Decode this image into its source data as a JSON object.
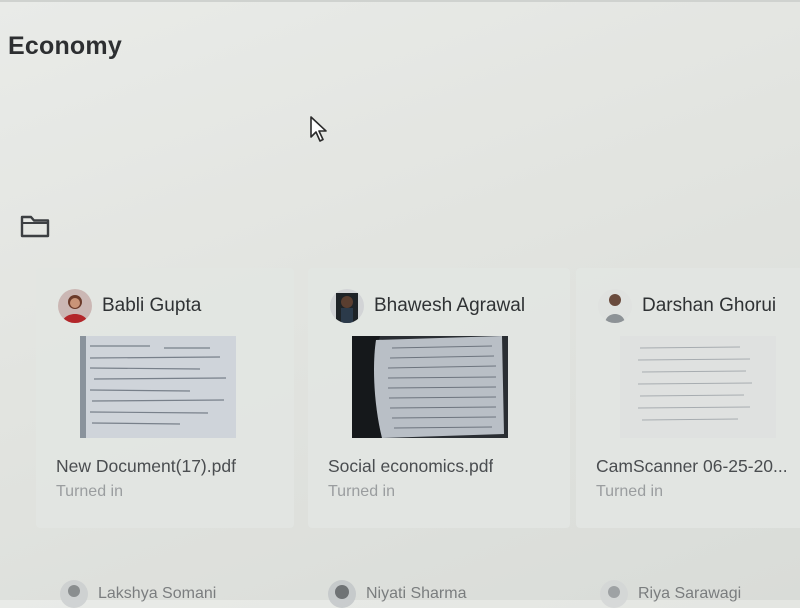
{
  "page": {
    "title": "Economy"
  },
  "icons": {
    "folder": "folder-icon",
    "cursor": "mouse-pointer-icon"
  },
  "submissions": [
    {
      "student": "Babli Gupta",
      "file": "New Document(17).pdf",
      "status": "Turned in"
    },
    {
      "student": "Bhawesh Agrawal",
      "file": "Social economics.pdf",
      "status": "Turned in"
    },
    {
      "student": "Darshan Ghorui",
      "file": "CamScanner 06-25-20...",
      "status": "Turned in"
    }
  ],
  "next_row": [
    {
      "student": "Lakshya Somani"
    },
    {
      "student": "Niyati Sharma"
    },
    {
      "student": "Riya Sarawagi"
    }
  ],
  "colors": {
    "background": "#e5e7e4",
    "card": "#e2e5e2",
    "title_text": "#2d2f31",
    "status_text": "#9a9d9f"
  }
}
